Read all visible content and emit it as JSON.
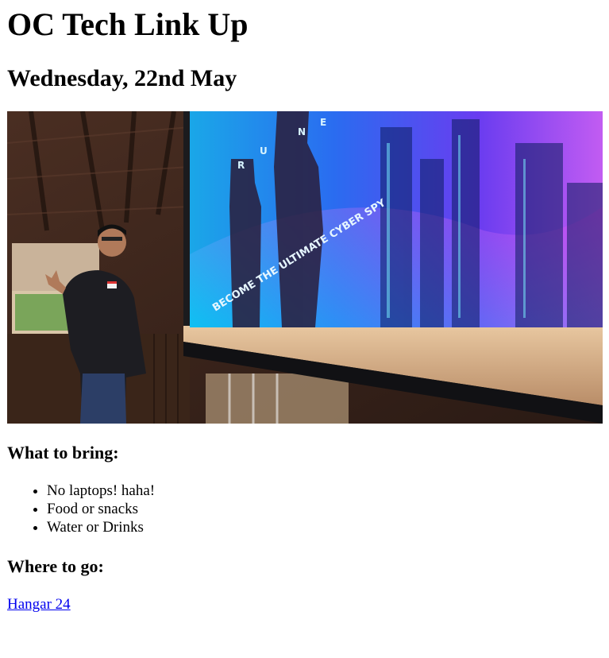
{
  "header": {
    "title": "OC Tech Link Up",
    "date": "Wednesday, 22nd May"
  },
  "hero_image": {
    "description": "Presenter beside projection screen",
    "slide_text": "BECOME THE ULTIMATE CYBER SPY",
    "slide_letters": [
      "R",
      "U",
      "N",
      "E"
    ]
  },
  "bring": {
    "heading": "What to bring:",
    "items": [
      "No laptops! haha!",
      "Food or snacks",
      "Water or Drinks"
    ]
  },
  "location": {
    "heading": "Where to go:",
    "link_text": "Hangar 24"
  },
  "colors": {
    "link": "#0000ee",
    "text": "#000000",
    "background": "#ffffff"
  }
}
